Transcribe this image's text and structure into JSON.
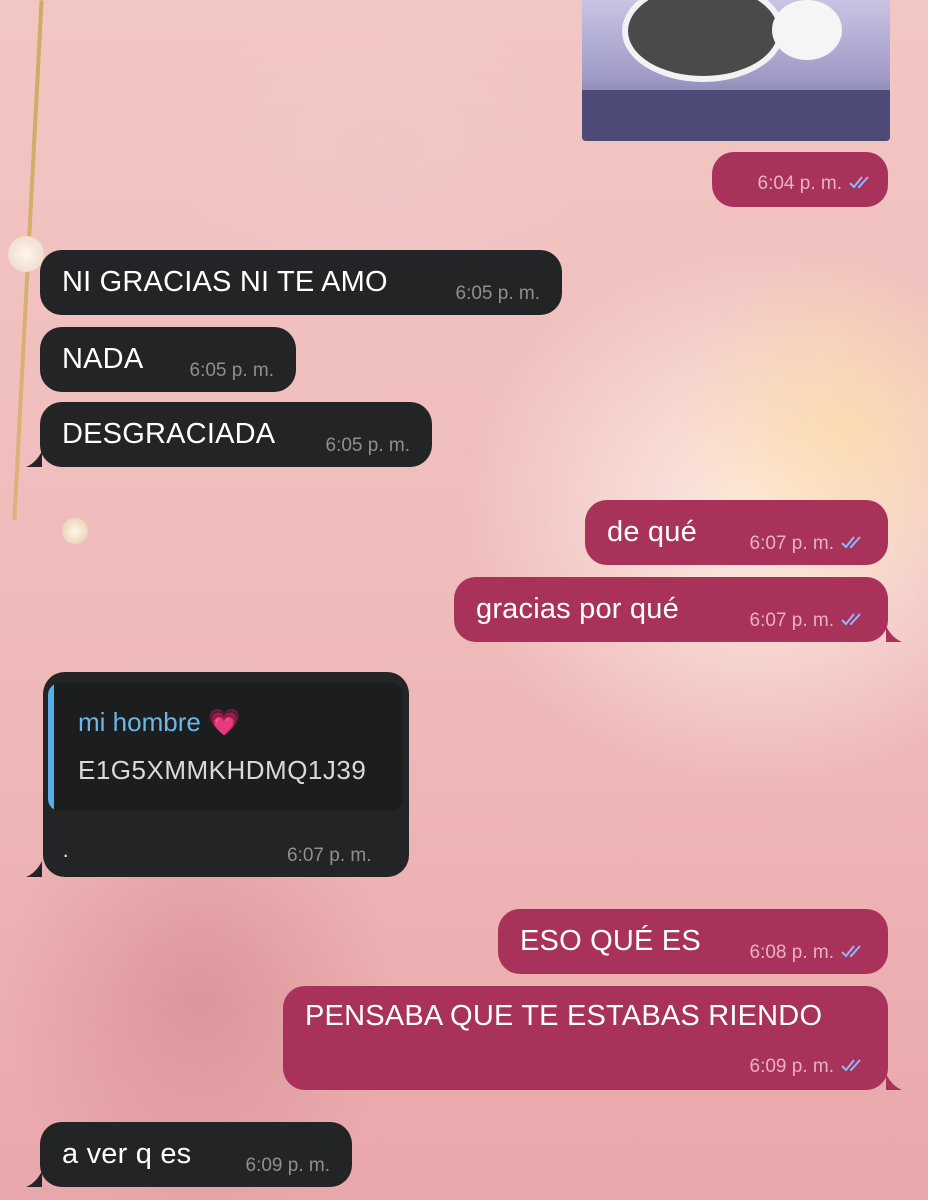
{
  "chat": {
    "messages": [
      {
        "id": "m1",
        "dir": "out",
        "text": "",
        "time": "6:04 p. m.",
        "read": true
      },
      {
        "id": "m2",
        "dir": "in",
        "text": "NI GRACIAS NI TE AMO",
        "time": "6:05 p. m."
      },
      {
        "id": "m3",
        "dir": "in",
        "text": "NADA",
        "time": "6:05 p. m."
      },
      {
        "id": "m4",
        "dir": "in",
        "text": "DESGRACIADA",
        "time": "6:05 p. m."
      },
      {
        "id": "m5",
        "dir": "out",
        "text": "de qué",
        "time": "6:07 p. m.",
        "read": true
      },
      {
        "id": "m6",
        "dir": "out",
        "text": "gracias por qué",
        "time": "6:07 p. m.",
        "read": true
      },
      {
        "id": "m7",
        "dir": "in",
        "text": "·",
        "time": "6:07 p. m.",
        "quote": {
          "author": "mi hombre 💗",
          "text": "E1G5XMMKHDMQ1J39"
        }
      },
      {
        "id": "m8",
        "dir": "out",
        "text": "ESO QUÉ ES",
        "time": "6:08 p. m.",
        "read": true
      },
      {
        "id": "m9",
        "dir": "out",
        "text": "PENSABA QUE TE ESTABAS RIENDO",
        "time": "6:09 p. m.",
        "read": true
      },
      {
        "id": "m10",
        "dir": "in",
        "text": "a ver q es",
        "time": "6:09 p. m."
      }
    ]
  },
  "icons": {
    "read_receipt": "double-check-icon",
    "image": "image-thumbnail"
  },
  "colors": {
    "incoming": "#232425",
    "outgoing": "#a8325a",
    "quote_accent": "#59aee3",
    "check": "#8fb8ff"
  }
}
